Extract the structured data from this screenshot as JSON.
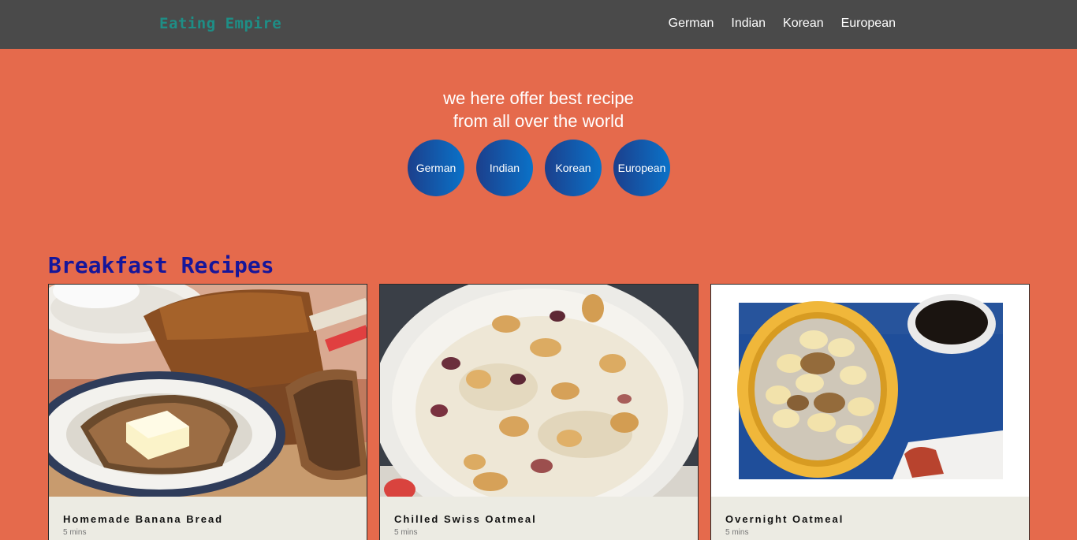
{
  "nav": {
    "brand": "Eating Empire",
    "links": [
      "German",
      "Indian",
      "Korean",
      "European"
    ]
  },
  "hero": {
    "line1": "we here offer best recipe",
    "line2": "from all over the world",
    "buttons": [
      "German",
      "Indian",
      "Korean",
      "European"
    ]
  },
  "section": {
    "title": "Breakfast Recipes"
  },
  "cards": [
    {
      "title": "Homemade Banana Bread",
      "meta": "5 mins"
    },
    {
      "title": "Chilled Swiss Oatmeal",
      "meta": "5 mins"
    },
    {
      "title": "Overnight Oatmeal",
      "meta": "5 mins"
    }
  ],
  "colors": {
    "navbar": "#4a4a4a",
    "brand": "#1e8e86",
    "page_background": "#e56a4c",
    "button_gradient_start": "#1c3f8c",
    "button_gradient_end": "#0a72c8",
    "section_title": "#16169a",
    "card_body": "#ecebe3"
  }
}
